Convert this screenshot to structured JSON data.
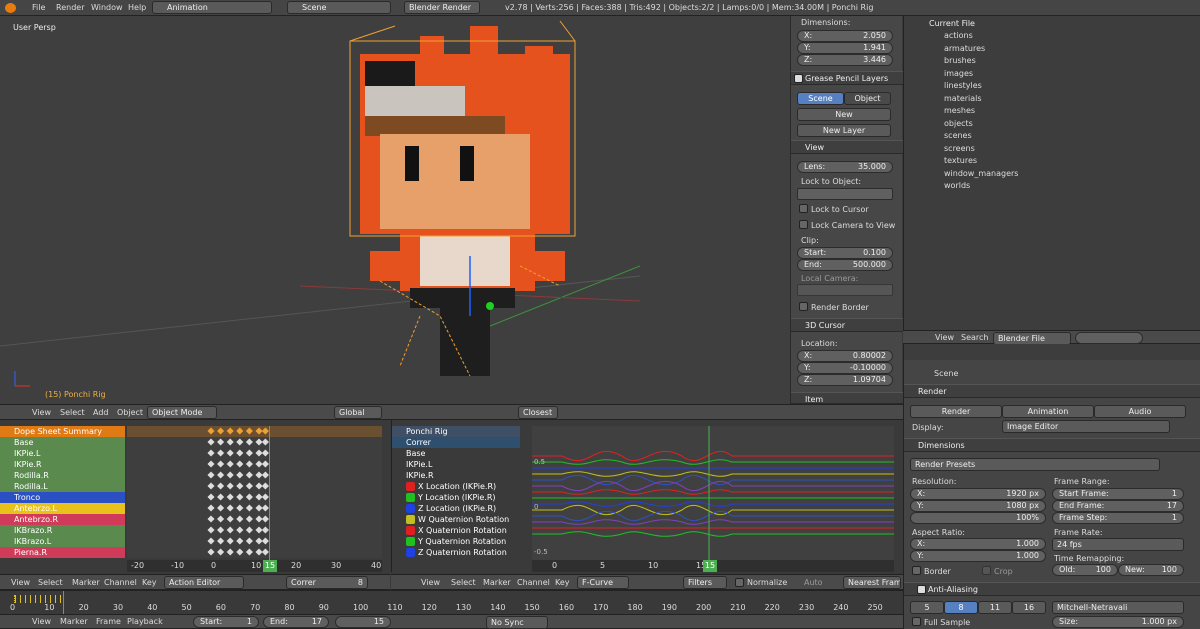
{
  "topbar": {
    "menus": [
      "File",
      "Render",
      "Window",
      "Help"
    ],
    "layout": "Animation",
    "scene": "Scene",
    "engine": "Blender Render",
    "stats": "v2.78 | Verts:256 | Faces:388 | Tris:492 | Objects:2/2 | Lamps:0/0 | Mem:34.00M | Ponchi Rig"
  },
  "viewport": {
    "label": "User Persp",
    "object_label": "(15) Ponchi Rig"
  },
  "npanel": {
    "dimensions_title": "Dimensions:",
    "dims": [
      {
        "k": "X:",
        "v": "2.050"
      },
      {
        "k": "Y:",
        "v": "1.941"
      },
      {
        "k": "Z:",
        "v": "3.446"
      }
    ],
    "grease_title": "Grease Pencil Layers",
    "tab_scene": "Scene",
    "tab_object": "Object",
    "new_btn": "New",
    "new_layer_btn": "New Layer",
    "view_title": "View",
    "lens_k": "Lens:",
    "lens_v": "35.000",
    "lock_obj": "Lock to Object:",
    "lock_cursor": "Lock to Cursor",
    "lock_camera": "Lock Camera to View",
    "clip": "Clip:",
    "start_k": "Start:",
    "start_v": "0.100",
    "end_k": "End:",
    "end_v": "500.000",
    "local_cam": "Local Camera:",
    "render_border": "Render Border",
    "cursor_title": "3D Cursor",
    "location": "Location:",
    "loc": [
      {
        "k": "X:",
        "v": "0.80002"
      },
      {
        "k": "Y:",
        "v": "-0.10000"
      },
      {
        "k": "Z:",
        "v": "1.09704"
      }
    ],
    "item_title": "Item"
  },
  "outliner": {
    "root": "Current File",
    "items": [
      "actions",
      "armatures",
      "brushes",
      "images",
      "linestyles",
      "materials",
      "meshes",
      "objects",
      "scenes",
      "screens",
      "textures",
      "window_managers",
      "worlds"
    ],
    "menu_view": "View",
    "menu_search": "Search",
    "mode": "Blender File"
  },
  "props": {
    "scene": "Scene",
    "render_title": "Render",
    "render_btn": "Render",
    "anim_btn": "Animation",
    "audio_btn": "Audio",
    "display_k": "Display:",
    "display_v": "Image Editor",
    "dimensions_title": "Dimensions",
    "presets": "Render Presets",
    "resolution": "Resolution:",
    "res_x": "1920 px",
    "res_y": "1080 px",
    "res_pct": "100%",
    "x_k": "X:",
    "y_k": "Y:",
    "frame_range": "Frame Range:",
    "start_frame_k": "Start Frame:",
    "start_frame_v": "1",
    "end_frame_k": "End Frame:",
    "end_frame_v": "17",
    "frame_step_k": "Frame Step:",
    "frame_step_v": "1",
    "aspect": "Aspect Ratio:",
    "asp_x": "1.000",
    "asp_y": "1.000",
    "frame_rate": "Frame Rate:",
    "fps": "24 fps",
    "remap": "Time Remapping:",
    "old_k": "Old:",
    "old_v": "100",
    "new_k": "New:",
    "new_v": "100",
    "border": "Border",
    "crop": "Crop",
    "aa_title": "Anti-Aliasing",
    "aa_samples": [
      "5",
      "8",
      "11",
      "16"
    ],
    "aa_filter": "Mitchell-Netravali",
    "full_sample": "Full Sample",
    "size_k": "Size:",
    "size_v": "1.000 px"
  },
  "view3d_header": {
    "menus": [
      "View",
      "Select",
      "Add",
      "Object"
    ],
    "mode": "Object Mode",
    "orient": "Global",
    "snap": "Closest"
  },
  "dopesheet": {
    "rows": [
      {
        "n": "Dope Sheet Summary",
        "c": "#e07a14"
      },
      {
        "n": "Base",
        "c": "#5a8a4e"
      },
      {
        "n": "IKPie.L",
        "c": "#5a8a4e"
      },
      {
        "n": "IKPie.R",
        "c": "#5a8a4e"
      },
      {
        "n": "Rodilla.R",
        "c": "#5a8a4e"
      },
      {
        "n": "Rodilla.L",
        "c": "#5a8a4e"
      },
      {
        "n": "Tronco",
        "c": "#2b50c4"
      },
      {
        "n": "Antebrzo.L",
        "c": "#e8c21a"
      },
      {
        "n": "Antebrzo.R",
        "c": "#d03b5a"
      },
      {
        "n": "IKBrazo.R",
        "c": "#5a8a4e"
      },
      {
        "n": "IKBrazo.L",
        "c": "#5a8a4e"
      },
      {
        "n": "Pierna.R",
        "c": "#d03b5a"
      }
    ],
    "ruler": [
      "-20",
      "-10",
      "0",
      "10",
      "20",
      "30",
      "40"
    ],
    "frame": "15",
    "menus": [
      "View",
      "Select",
      "Marker",
      "Channel",
      "Key"
    ],
    "editor": "Action Editor",
    "action": "Correr",
    "users": "8"
  },
  "graph": {
    "rows": [
      {
        "n": "Ponchi Rig",
        "c": "#3f4f66"
      },
      {
        "n": "Correr",
        "c": "#2f4f6f"
      },
      {
        "n": "Base",
        "c": "#3a3a3a"
      },
      {
        "n": "IKPie.L",
        "c": "#3a3a3a"
      },
      {
        "n": "IKPie.R",
        "c": "#3a3a3a"
      },
      {
        "n": "X Location (IKPie.R)",
        "c": "#e02020"
      },
      {
        "n": "Y Location (IKPie.R)",
        "c": "#20c020"
      },
      {
        "n": "Z Location (IKPie.R)",
        "c": "#2040e0"
      },
      {
        "n": "W Quaternion Rotation",
        "c": "#c0c020"
      },
      {
        "n": "X Quaternion Rotation",
        "c": "#e02020"
      },
      {
        "n": "Y Quaternion Rotation",
        "c": "#20c020"
      },
      {
        "n": "Z Quaternion Rotation",
        "c": "#2040e0"
      }
    ],
    "ruler": [
      "0",
      "5",
      "10",
      "15"
    ],
    "yticks": [
      "0.5",
      "0",
      "-0.5"
    ],
    "frame": "15",
    "menus": [
      "View",
      "Select",
      "Marker",
      "Channel",
      "Key"
    ],
    "mode": "F-Curve",
    "filters": "Filters",
    "normalize": "Normalize",
    "auto": "Auto",
    "nearest": "Nearest Frame"
  },
  "timeline": {
    "ruler": [
      "0",
      "10",
      "20",
      "30",
      "40",
      "50",
      "60",
      "70",
      "80",
      "90",
      "100",
      "110",
      "120",
      "130",
      "140",
      "150",
      "160",
      "170",
      "180",
      "190",
      "200",
      "210",
      "220",
      "230",
      "240",
      "250"
    ],
    "menus": [
      "View",
      "Marker",
      "Frame",
      "Playback"
    ],
    "start_k": "Start:",
    "start_v": "1",
    "end_k": "End:",
    "end_v": "17",
    "cur": "15",
    "sync": "No Sync"
  },
  "colors": {
    "accent": "#5680c2",
    "orange": "#e07a14",
    "timeline_green": "#4caf50"
  }
}
